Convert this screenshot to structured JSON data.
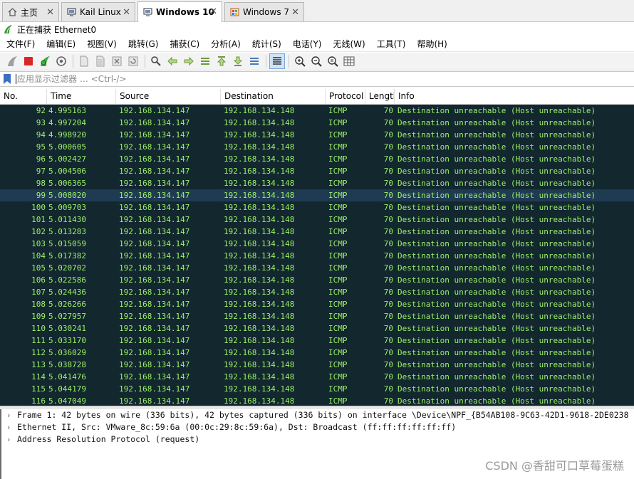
{
  "vm_tabs": [
    {
      "label": "主页",
      "icon": "home-icon",
      "active": false
    },
    {
      "label": "Kail Linux",
      "icon": "vm-icon",
      "active": false
    },
    {
      "label": "Windows 10",
      "icon": "vm-icon",
      "active": true
    },
    {
      "label": "Windows 7",
      "icon": "vm-windows-icon",
      "active": false
    }
  ],
  "title": "正在捕获 Ethernet0",
  "menu": [
    "文件(F)",
    "编辑(E)",
    "视图(V)",
    "跳转(G)",
    "捕获(C)",
    "分析(A)",
    "统计(S)",
    "电话(Y)",
    "无线(W)",
    "工具(T)",
    "帮助(H)"
  ],
  "toolbar": [
    "start-capture-icon",
    "stop-capture-icon",
    "restart-capture-icon",
    "capture-options-icon",
    "open-file-icon",
    "save-file-icon",
    "close-file-icon",
    "reload-file-icon",
    "find-packet-icon",
    "go-back-icon",
    "go-forward-icon",
    "go-to-packet-icon",
    "first-packet-icon",
    "last-packet-icon",
    "autoscroll-icon",
    "colorize-icon",
    "zoom-in-icon",
    "zoom-out-icon",
    "zoom-normal-icon",
    "resize-columns-icon"
  ],
  "filter": {
    "placeholder": "应用显示过滤器 … <Ctrl-/>"
  },
  "columns": [
    "No.",
    "Time",
    "Source",
    "Destination",
    "Protocol",
    "Length",
    "Info"
  ],
  "packets": [
    {
      "no": "92",
      "time": "4.995163",
      "src": "192.168.134.147",
      "dst": "192.168.134.148",
      "proto": "ICMP",
      "len": "70",
      "info": "Destination unreachable (Host unreachable)"
    },
    {
      "no": "93",
      "time": "4.997204",
      "src": "192.168.134.147",
      "dst": "192.168.134.148",
      "proto": "ICMP",
      "len": "70",
      "info": "Destination unreachable (Host unreachable)"
    },
    {
      "no": "94",
      "time": "4.998920",
      "src": "192.168.134.147",
      "dst": "192.168.134.148",
      "proto": "ICMP",
      "len": "70",
      "info": "Destination unreachable (Host unreachable)"
    },
    {
      "no": "95",
      "time": "5.000605",
      "src": "192.168.134.147",
      "dst": "192.168.134.148",
      "proto": "ICMP",
      "len": "70",
      "info": "Destination unreachable (Host unreachable)"
    },
    {
      "no": "96",
      "time": "5.002427",
      "src": "192.168.134.147",
      "dst": "192.168.134.148",
      "proto": "ICMP",
      "len": "70",
      "info": "Destination unreachable (Host unreachable)"
    },
    {
      "no": "97",
      "time": "5.004506",
      "src": "192.168.134.147",
      "dst": "192.168.134.148",
      "proto": "ICMP",
      "len": "70",
      "info": "Destination unreachable (Host unreachable)"
    },
    {
      "no": "98",
      "time": "5.006365",
      "src": "192.168.134.147",
      "dst": "192.168.134.148",
      "proto": "ICMP",
      "len": "70",
      "info": "Destination unreachable (Host unreachable)"
    },
    {
      "no": "99",
      "time": "5.008020",
      "src": "192.168.134.147",
      "dst": "192.168.134.148",
      "proto": "ICMP",
      "len": "70",
      "info": "Destination unreachable (Host unreachable)",
      "selected": true
    },
    {
      "no": "100",
      "time": "5.009703",
      "src": "192.168.134.147",
      "dst": "192.168.134.148",
      "proto": "ICMP",
      "len": "70",
      "info": "Destination unreachable (Host unreachable)"
    },
    {
      "no": "101",
      "time": "5.011430",
      "src": "192.168.134.147",
      "dst": "192.168.134.148",
      "proto": "ICMP",
      "len": "70",
      "info": "Destination unreachable (Host unreachable)"
    },
    {
      "no": "102",
      "time": "5.013283",
      "src": "192.168.134.147",
      "dst": "192.168.134.148",
      "proto": "ICMP",
      "len": "70",
      "info": "Destination unreachable (Host unreachable)"
    },
    {
      "no": "103",
      "time": "5.015059",
      "src": "192.168.134.147",
      "dst": "192.168.134.148",
      "proto": "ICMP",
      "len": "70",
      "info": "Destination unreachable (Host unreachable)"
    },
    {
      "no": "104",
      "time": "5.017382",
      "src": "192.168.134.147",
      "dst": "192.168.134.148",
      "proto": "ICMP",
      "len": "70",
      "info": "Destination unreachable (Host unreachable)"
    },
    {
      "no": "105",
      "time": "5.020702",
      "src": "192.168.134.147",
      "dst": "192.168.134.148",
      "proto": "ICMP",
      "len": "70",
      "info": "Destination unreachable (Host unreachable)"
    },
    {
      "no": "106",
      "time": "5.022586",
      "src": "192.168.134.147",
      "dst": "192.168.134.148",
      "proto": "ICMP",
      "len": "70",
      "info": "Destination unreachable (Host unreachable)"
    },
    {
      "no": "107",
      "time": "5.024436",
      "src": "192.168.134.147",
      "dst": "192.168.134.148",
      "proto": "ICMP",
      "len": "70",
      "info": "Destination unreachable (Host unreachable)"
    },
    {
      "no": "108",
      "time": "5.026266",
      "src": "192.168.134.147",
      "dst": "192.168.134.148",
      "proto": "ICMP",
      "len": "70",
      "info": "Destination unreachable (Host unreachable)"
    },
    {
      "no": "109",
      "time": "5.027957",
      "src": "192.168.134.147",
      "dst": "192.168.134.148",
      "proto": "ICMP",
      "len": "70",
      "info": "Destination unreachable (Host unreachable)"
    },
    {
      "no": "110",
      "time": "5.030241",
      "src": "192.168.134.147",
      "dst": "192.168.134.148",
      "proto": "ICMP",
      "len": "70",
      "info": "Destination unreachable (Host unreachable)"
    },
    {
      "no": "111",
      "time": "5.033170",
      "src": "192.168.134.147",
      "dst": "192.168.134.148",
      "proto": "ICMP",
      "len": "70",
      "info": "Destination unreachable (Host unreachable)"
    },
    {
      "no": "112",
      "time": "5.036029",
      "src": "192.168.134.147",
      "dst": "192.168.134.148",
      "proto": "ICMP",
      "len": "70",
      "info": "Destination unreachable (Host unreachable)"
    },
    {
      "no": "113",
      "time": "5.038728",
      "src": "192.168.134.147",
      "dst": "192.168.134.148",
      "proto": "ICMP",
      "len": "70",
      "info": "Destination unreachable (Host unreachable)"
    },
    {
      "no": "114",
      "time": "5.041476",
      "src": "192.168.134.147",
      "dst": "192.168.134.148",
      "proto": "ICMP",
      "len": "70",
      "info": "Destination unreachable (Host unreachable)"
    },
    {
      "no": "115",
      "time": "5.044179",
      "src": "192.168.134.147",
      "dst": "192.168.134.148",
      "proto": "ICMP",
      "len": "70",
      "info": "Destination unreachable (Host unreachable)"
    },
    {
      "no": "116",
      "time": "5.047049",
      "src": "192.168.134.147",
      "dst": "192.168.134.148",
      "proto": "ICMP",
      "len": "70",
      "info": "Destination unreachable (Host unreachable)"
    }
  ],
  "details": [
    "Frame 1: 42 bytes on wire (336 bits), 42 bytes captured (336 bits) on interface \\Device\\NPF_{B54AB108-9C63-42D1-9618-2DE0238",
    "Ethernet II, Src: VMware_8c:59:6a (00:0c:29:8c:59:6a), Dst: Broadcast (ff:ff:ff:ff:ff:ff)",
    "Address Resolution Protocol (request)"
  ],
  "watermark": "CSDN @香甜可口草莓蛋糕",
  "colors": {
    "list_bg": "#12272e",
    "row_fg": "#9ef06a",
    "selected_row_bg": "#1f3b52",
    "shark_fin": "#3a9a3a"
  }
}
